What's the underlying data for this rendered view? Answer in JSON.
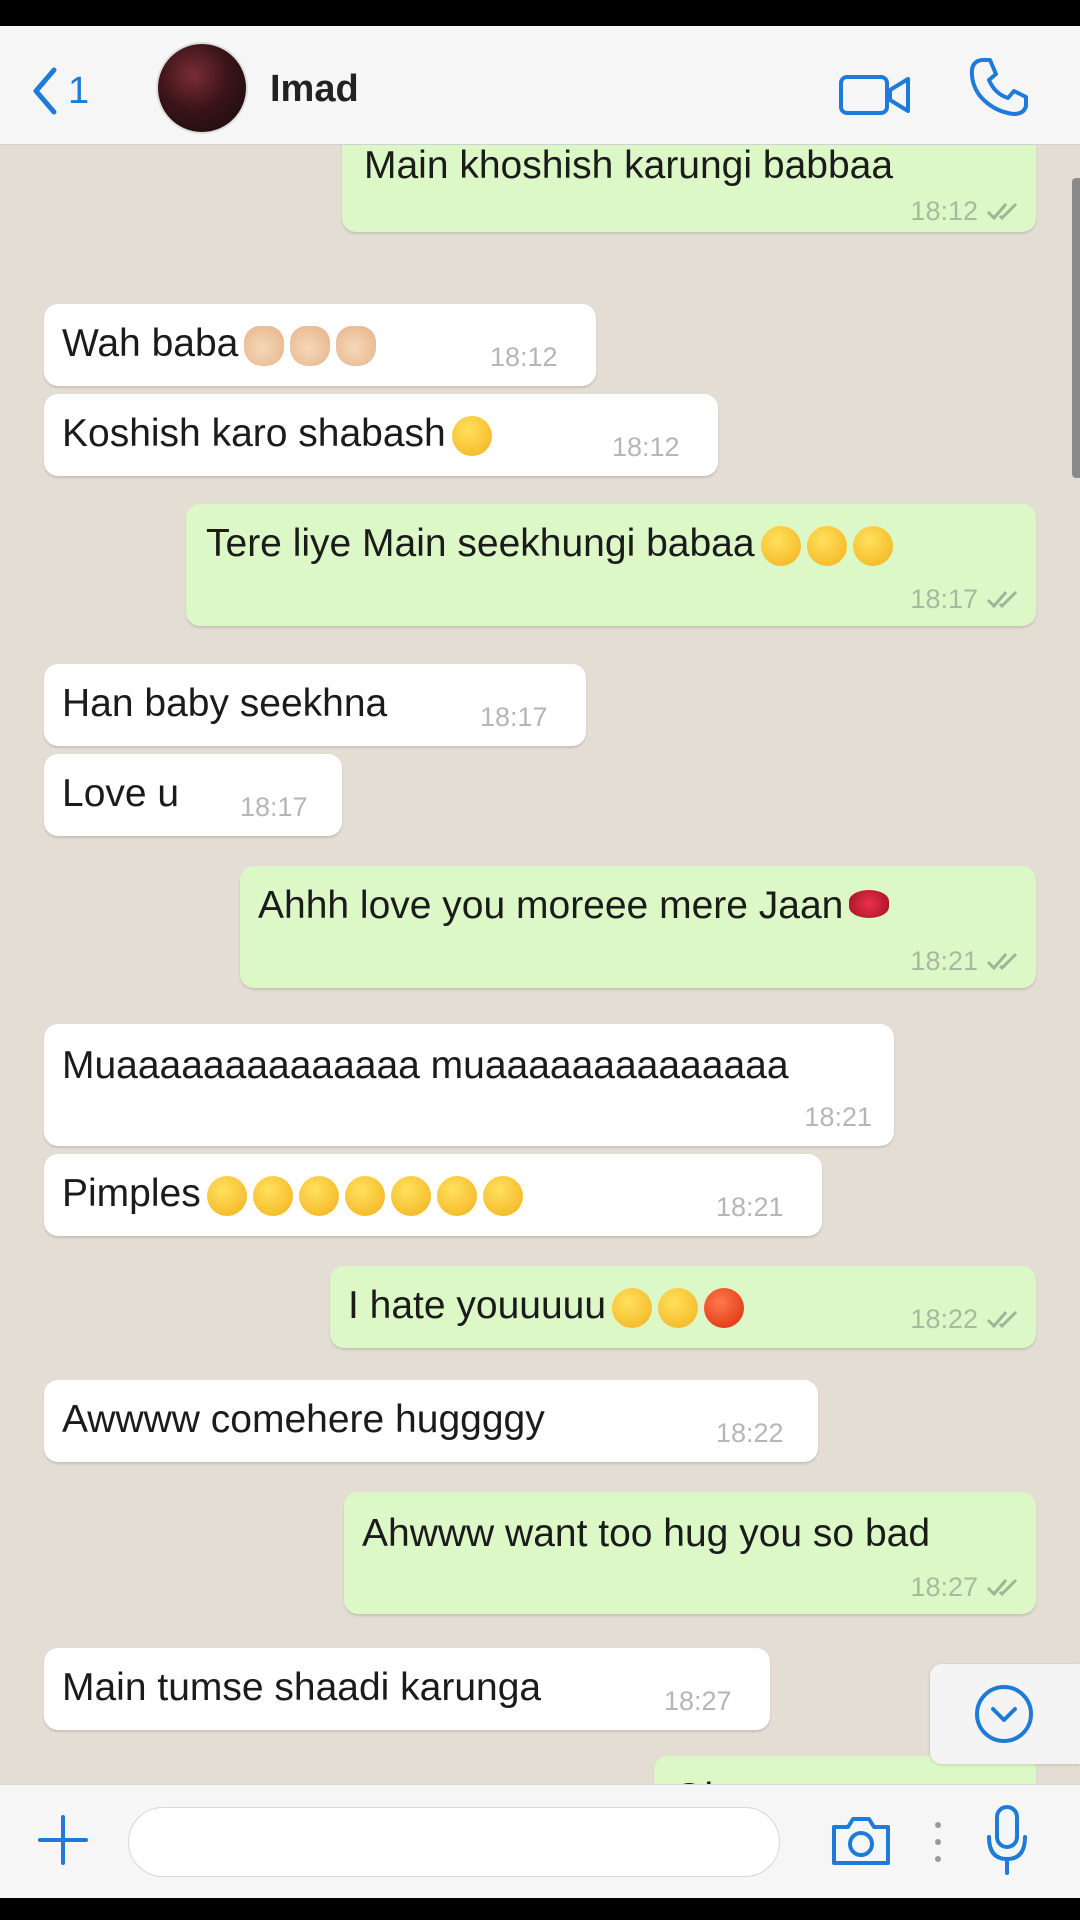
{
  "header": {
    "back_count": "1",
    "contact_name": "Imad"
  },
  "messages": [
    {
      "dir": "out",
      "text": "Main khoshish karungi babbaa",
      "time": "18:12",
      "ticks": true,
      "emojis": []
    },
    {
      "dir": "in",
      "text": "Wah baba",
      "time": "18:12",
      "emojis": [
        "clap",
        "clap",
        "clap"
      ]
    },
    {
      "dir": "in",
      "text": "Koshish karo shabash",
      "time": "18:12",
      "emojis": [
        "kiss"
      ]
    },
    {
      "dir": "out",
      "text": "Tere liye Main seekhungi babaa",
      "time": "18:17",
      "ticks": true,
      "emojis": [
        "kiss",
        "wink",
        "wink"
      ]
    },
    {
      "dir": "in",
      "text": "Han baby seekhna",
      "time": "18:17",
      "emojis": []
    },
    {
      "dir": "in",
      "text": "Love u",
      "time": "18:17",
      "emojis": []
    },
    {
      "dir": "out",
      "text": "Ahhh love you moreee mere Jaan",
      "time": "18:21",
      "ticks": true,
      "emojis": [
        "lips"
      ]
    },
    {
      "dir": "in",
      "text": "Muaaaaaaaaaaaaaa muaaaaaaaaaaaaaa",
      "time": "18:21",
      "emojis": []
    },
    {
      "dir": "in",
      "text": "Pimples",
      "time": "18:21",
      "emojis": [
        "hug",
        "hug",
        "hug",
        "wink",
        "wink",
        "wink",
        "wink"
      ]
    },
    {
      "dir": "out",
      "text": "I hate youuuuu",
      "time": "18:22",
      "ticks": true,
      "emojis": [
        "weary",
        "weary",
        "angry"
      ]
    },
    {
      "dir": "in",
      "text": "Awwww comehere huggggy",
      "time": "18:22",
      "emojis": []
    },
    {
      "dir": "out",
      "text": "Ahwww want too hug you so bad",
      "time": "18:27",
      "ticks": true,
      "emojis": []
    },
    {
      "dir": "in",
      "text": "Main tumse shaadi karunga",
      "time": "18:27",
      "emojis": []
    },
    {
      "dir": "out",
      "text": "Ohoooo",
      "time": "",
      "ticks": false,
      "emojis": []
    }
  ],
  "footer": {
    "input_placeholder": ""
  },
  "colors": {
    "accent": "#1e7bd9",
    "outgoing_bubble": "#dcf8c6",
    "incoming_bubble": "#ffffff",
    "chat_background": "#e3ddd4"
  },
  "icons": [
    "back-chevron-icon",
    "video-call-icon",
    "phone-icon",
    "scroll-down-icon",
    "plus-icon",
    "camera-icon",
    "microphone-icon"
  ]
}
